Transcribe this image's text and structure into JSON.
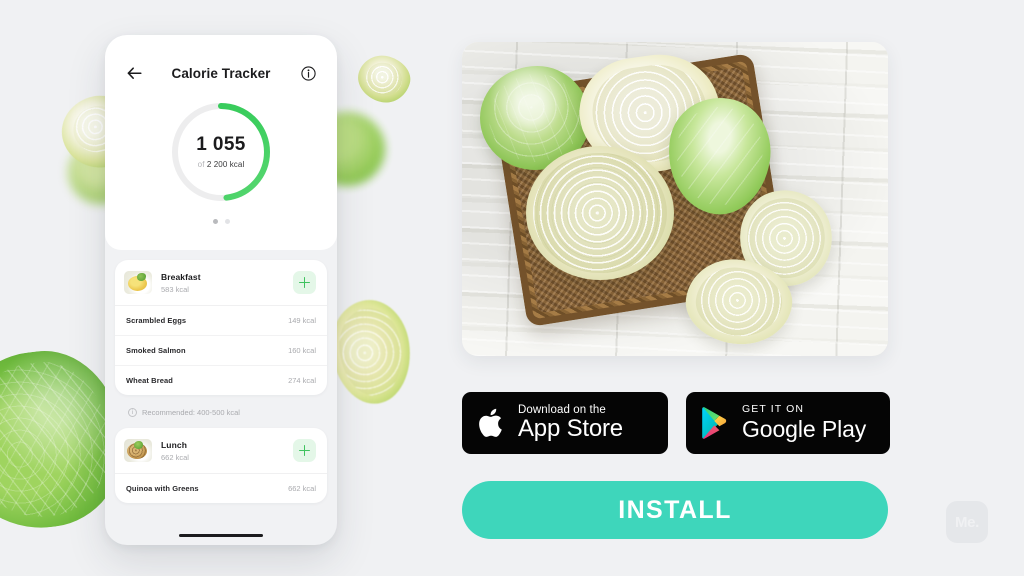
{
  "theme": {
    "background": "#f0f1f3",
    "accent_green": "#3fc35f",
    "install_teal": "#3ed6bb",
    "badge_black": "#050505",
    "ring_track": "#ededee"
  },
  "phone": {
    "nav": {
      "back_icon": "arrow-left-icon",
      "title": "Calorie Tracker",
      "info_icon": "info-circle-icon"
    },
    "ring": {
      "value": "1 055",
      "of_label": "of",
      "goal": "2 200 kcal",
      "consumed_kcal": 1055,
      "goal_kcal": 2200,
      "percent": 48
    },
    "pager": {
      "total": 2,
      "active_index": 0
    },
    "meals": [
      {
        "name": "Breakfast",
        "kcal": "583 kcal",
        "thumb": "scrambled-eggs-thumb",
        "add_icon": "plus-icon",
        "items": [
          {
            "name": "Scrambled Eggs",
            "kcal": "149 kcal"
          },
          {
            "name": "Smoked Salmon",
            "kcal": "160 kcal"
          },
          {
            "name": "Wheat Bread",
            "kcal": "274 kcal"
          }
        ]
      },
      {
        "name": "Lunch",
        "kcal": "662 kcal",
        "thumb": "quinoa-bowl-thumb",
        "add_icon": "plus-icon",
        "items": [
          {
            "name": "Quinoa with Greens",
            "kcal": "662 kcal"
          }
        ]
      }
    ],
    "recommended": {
      "icon": "info-circle-icon",
      "text": "Recommended: 400-500 kcal"
    },
    "home_indicator": "home-indicator-bar"
  },
  "hero": {
    "alt": "fresh cabbages in a wicker basket on whitewashed wood"
  },
  "badges": [
    {
      "id": "app-store",
      "icon": "apple-logo-icon",
      "small_text": "Download on the",
      "big_text": "App Store"
    },
    {
      "id": "google-play",
      "icon": "google-play-triangle-icon",
      "small_text": "GET IT ON",
      "big_text": "Google Play"
    }
  ],
  "install": {
    "label": "INSTALL"
  },
  "watermark": {
    "label": "Me."
  }
}
